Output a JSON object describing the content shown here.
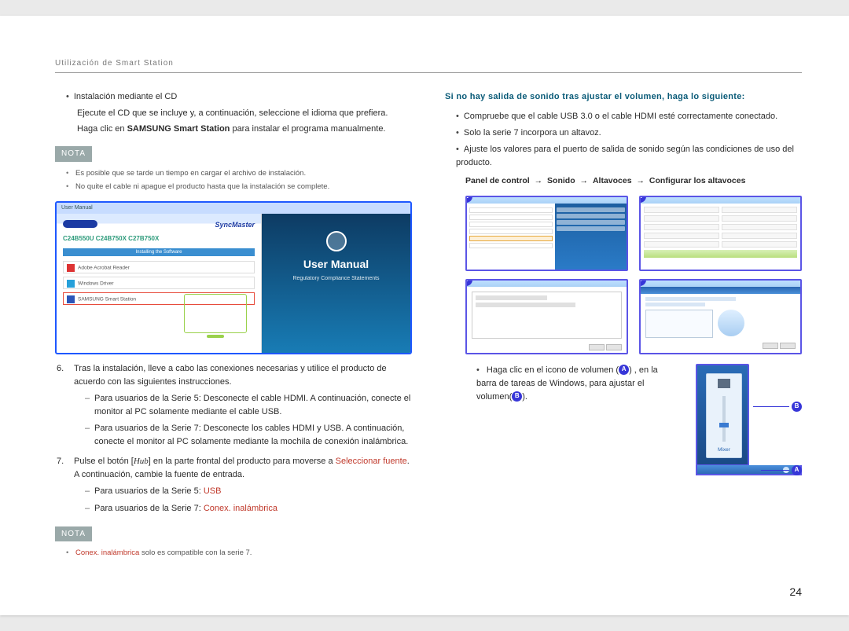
{
  "header": {
    "title": "Utilización de Smart Station"
  },
  "page_number": "24",
  "left": {
    "cd_install": "Instalación mediante el CD",
    "cd_line1_a": "Ejecute el CD que se incluye y, a continuación, seleccione el idioma que prefiera.",
    "cd_line2_a": "Haga clic en ",
    "cd_line2_b": "SAMSUNG Smart Station",
    "cd_line2_c": " para instalar el programa manualmente.",
    "nota": "NOTA",
    "nota_items": [
      "Es posible que se tarde un tiempo en cargar el archivo de instalación.",
      "No quite el cable ni apague el producto hasta que la instalación se complete."
    ],
    "figure": {
      "title_bar": "User Manual",
      "syncmaster": "SyncMaster",
      "models": "C24B550U C24B750X C27B750X",
      "install_bar": "Installing the Software",
      "rows": [
        "Adobe Acrobat Reader",
        "Windows Driver",
        "SAMSUNG Smart Station"
      ],
      "um": "User Manual",
      "rcs": "Regulatory Compliance Statements"
    },
    "item6": {
      "n": "6.",
      "main": "Tras la instalación, lleve a cabo las conexiones necesarias y utilice el producto de acuerdo con las siguientes instrucciones.",
      "s5": "Para usuarios de la Serie 5: Desconecte el cable HDMI. A continuación, conecte el monitor al PC solamente mediante el cable USB.",
      "s7": "Para usuarios de la Serie 7: Desconecte los cables HDMI y USB. A continuación, conecte el monitor al PC solamente mediante la mochila de conexión inalámbrica."
    },
    "item7": {
      "n": "7.",
      "a": "Pulse el botón [",
      "hub": "Hub",
      "b": "] en la parte frontal del producto para moverse a ",
      "red1": "Seleccionar fuente",
      "c": ". A continuación, cambie la fuente de entrada.",
      "s5_a": "Para usuarios de la Serie 5: ",
      "s5_b": "USB",
      "s7_a": "Para usuarios de la Serie 7: ",
      "s7_b": "Conex. inalámbrica"
    },
    "nota2_a": "Conex. inalámbrica",
    "nota2_b": " solo es compatible con la serie 7."
  },
  "right": {
    "title": "Si no hay salida de sonido tras ajustar el volumen, haga lo siguiente:",
    "b1": "Compruebe que el cable USB 3.0 o el cable HDMI esté correctamente conectado.",
    "b2": "Solo la serie 7 incorpora un altavoz.",
    "b3": "Ajuste los valores para el puerto de salida de sonido según las condiciones de uso del producto.",
    "path": {
      "p1": "Panel de control",
      "p2": "Sonido",
      "p3": "Altavoces",
      "p4": "Configurar los altavoces",
      "arrow": "→"
    },
    "badges": {
      "1": "1",
      "2": "2",
      "3": "3",
      "4": "4"
    },
    "vol": {
      "l1": "Haga clic en el icono de volumen (",
      "l1b": ") , en la",
      "l2": "barra de tareas de Windows, para ajustar el",
      "l3": "volumen(",
      "l3b": ").",
      "A": "A",
      "B": "B",
      "mixer": "Mixer"
    }
  }
}
